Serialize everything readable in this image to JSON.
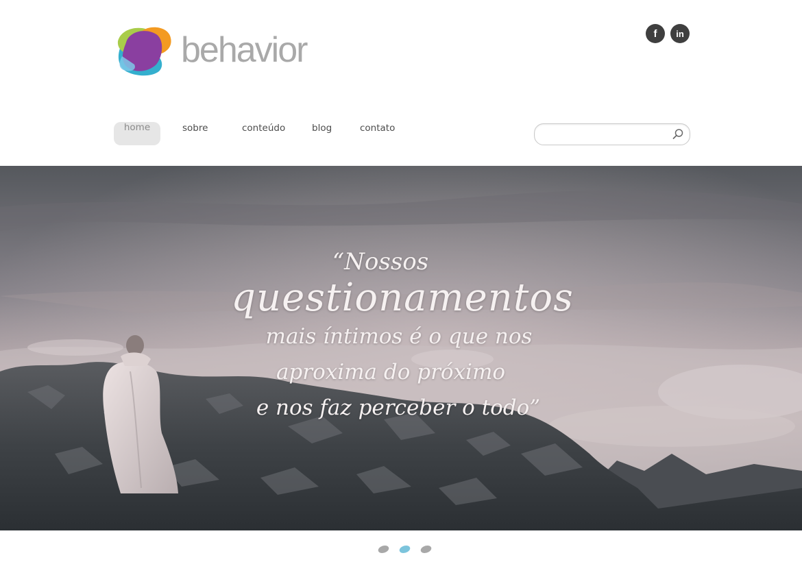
{
  "brand": {
    "name": "behavior"
  },
  "social": [
    {
      "id": "facebook",
      "icon": "facebook-icon",
      "glyph": "f"
    },
    {
      "id": "linkedin",
      "icon": "linkedin-icon",
      "glyph": "in"
    }
  ],
  "nav": {
    "items": [
      {
        "label": "home",
        "active": true
      },
      {
        "label": "sobre",
        "active": false
      },
      {
        "label": "conteúdo",
        "active": false
      },
      {
        "label": "blog",
        "active": false
      },
      {
        "label": "contato",
        "active": false
      }
    ]
  },
  "search": {
    "value": "",
    "placeholder": "",
    "icon": "search-icon"
  },
  "hero": {
    "quote_line1": "“Nossos",
    "quote_line2": "questionamentos",
    "quote_line3": "mais íntimos é o que nos",
    "quote_line4": "aproxima do próximo",
    "quote_line5": "e nos faz perceber o todo”"
  },
  "slider": {
    "count": 3,
    "active_index": 1
  },
  "colors": {
    "logo_purple": "#8a3fa0",
    "logo_orange": "#f39a21",
    "logo_green": "#a9cc4a",
    "logo_blue": "#1ea6c9",
    "dot_active": "#7cc4dc",
    "dot_inactive": "#a8a8a8"
  }
}
